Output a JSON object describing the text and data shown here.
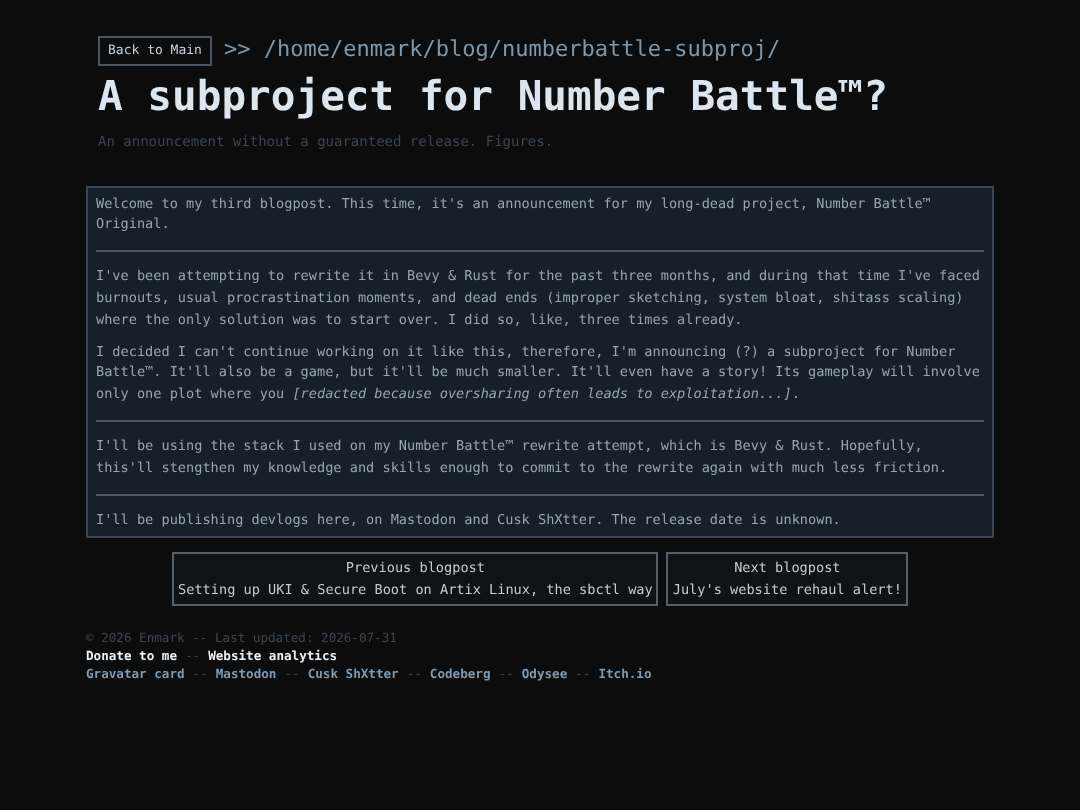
{
  "header": {
    "back_button": "Back to Main",
    "path": ">> /home/enmark/blog/numberbattle-subproj/",
    "title": "A subproject for Number Battle™?",
    "subtitle": "An announcement without a guaranteed release. Figures."
  },
  "sections": [
    [
      "Welcome to my third blogpost. This time, it's an announcement for my long-dead project, Number Battle™ Original."
    ],
    [
      "I've been attempting to rewrite it in Bevy & Rust for the past three months, and during that time I've faced burnouts, usual procrastination moments, and dead ends (improper sketching, system bloat, shitass scaling) where the only solution was to start over. I did so, like, three times already.",
      "I decided I can't continue working on it like this, therefore, I'm announcing (?) a subproject for Number Battle™. It'll also be a game, but it'll be much smaller. It'll even have a story! Its gameplay will involve only one plot where you *[redacted because oversharing often leads to exploitation...]*."
    ],
    [
      "I'll be using the stack I used on my Number Battle™ rewrite attempt, which is Bevy & Rust. Hopefully, this'll stengthen my knowledge and skills enough to commit to the rewrite again with much less friction."
    ],
    [
      "I'll be publishing devlogs here, on Mastodon and Cusk ShXtter. The release date is unknown."
    ]
  ],
  "nav": [
    {
      "label": "Previous blogpost",
      "title": "Setting up UKI & Secure Boot on Artix Linux, the sbctl way"
    },
    {
      "label": "Next blogpost",
      "title": "July's website rehaul alert!"
    }
  ],
  "footer": {
    "copyright": "© 2026 Enmark -- Last updated: 2026-07-31",
    "separator": "--",
    "link_rows": [
      {
        "kind": "primary",
        "links": [
          "Donate to me",
          "Website analytics"
        ]
      },
      {
        "kind": "secondary",
        "links": [
          "Gravatar card",
          "Mastodon",
          "Cusk ShXtter",
          "Codeberg",
          "Odysee",
          "Itch.io"
        ]
      }
    ]
  }
}
